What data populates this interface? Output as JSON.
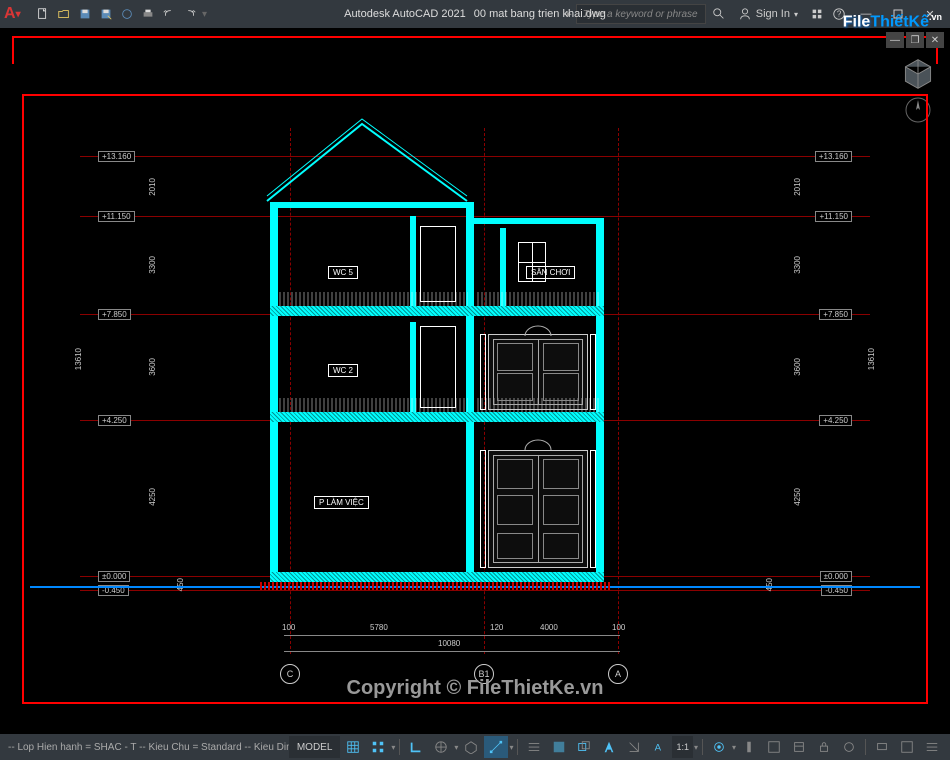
{
  "app": {
    "name": "Autodesk AutoCAD 2021",
    "file": "00 mat bang trien khai.dwg",
    "logo": "A"
  },
  "search": {
    "placeholder": "Type a keyword or phrase"
  },
  "user": {
    "signin": "Sign In"
  },
  "watermark": {
    "file": "File",
    "thiet": "Thiết",
    "ke": "Kế",
    "vn": ".vn"
  },
  "copyright": "Copyright © FileThietKe.vn",
  "drawing": {
    "elevations_left": [
      "+13.160",
      "+11.150",
      "+7.850",
      "+4.250",
      "±0.000",
      "-0.450"
    ],
    "elevations_right": [
      "+13.160",
      "+11.150",
      "+7.850",
      "+4.250",
      "±0.000",
      "-0.450"
    ],
    "dims_v_left": [
      "2010",
      "3300",
      "3600",
      "4250"
    ],
    "dims_v_right": [
      "2010",
      "3300",
      "3600",
      "4250"
    ],
    "dims_v_total_left": "13610",
    "dims_v_total_right": "13610",
    "dims_h": [
      "100",
      "5780",
      "4000",
      "100"
    ],
    "dims_h_total": "10080",
    "dims_h_sub": "120",
    "axes": [
      "C",
      "B1",
      "A"
    ],
    "rooms": {
      "wc5": "WC 5",
      "wc2": "WC 2",
      "plamviec": "P LÀM VIỆC",
      "sanchoi": "SÂN CHƠI"
    },
    "floor_dims": [
      "450",
      "450"
    ]
  },
  "status": {
    "text": "-- Lop Hien hanh = SHAC - T -- Kieu Chu = Standard -- Kieu Dim = STANDARD (Dsc= 0) -...",
    "model": "MODEL",
    "scale": "1:1"
  }
}
